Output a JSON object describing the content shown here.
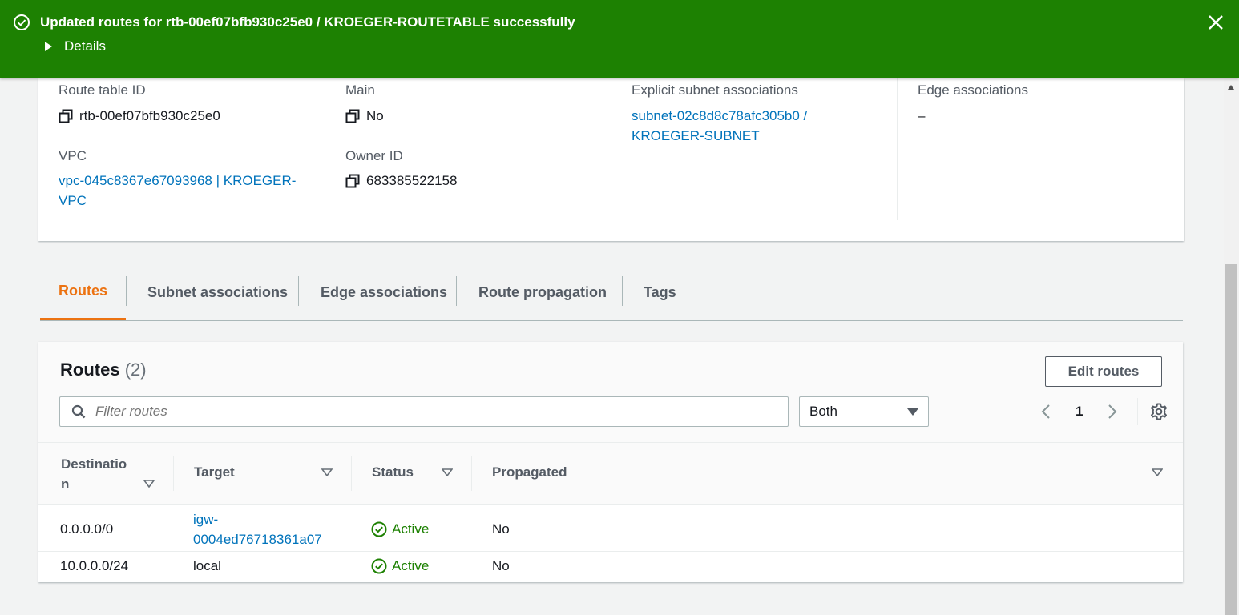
{
  "flash": {
    "message": "Updated routes for rtb-00ef07bfb930c25e0 / KROEGER-ROUTETABLE successfully",
    "details_label": "Details",
    "color": "#1d8102"
  },
  "details": {
    "route_table_id_label": "Route table ID",
    "route_table_id": "rtb-00ef07bfb930c25e0",
    "vpc_label": "VPC",
    "vpc_line1": "vpc-045c8367e67093968 | KROEGER-",
    "vpc_line2": "VPC",
    "main_label": "Main",
    "main_value": "No",
    "owner_id_label": "Owner ID",
    "owner_id": "683385522158",
    "explicit_label": "Explicit subnet associations",
    "explicit_line1": "subnet-02c8d8c78afc305b0 /",
    "explicit_line2": "KROEGER-SUBNET",
    "edge_label": "Edge associations",
    "edge_value": "–"
  },
  "tabs": [
    {
      "label": "Routes",
      "active": true
    },
    {
      "label": "Subnet associations"
    },
    {
      "label": "Edge associations"
    },
    {
      "label": "Route propagation"
    },
    {
      "label": "Tags"
    }
  ],
  "routes_panel": {
    "title": "Routes",
    "count": "(2)",
    "edit_button": "Edit routes",
    "filter_placeholder": "Filter routes",
    "select_value": "Both",
    "page": "1"
  },
  "table": {
    "headers": {
      "destination_line1": "Destinatio",
      "destination_line2": "n",
      "target": "Target",
      "status": "Status",
      "propagated": "Propagated"
    },
    "rows": [
      {
        "destination": "0.0.0.0/0",
        "target_line1": "igw-",
        "target_line2": "0004ed76718361a07",
        "status": "Active",
        "propagated": "No"
      },
      {
        "destination": "10.0.0.0/24",
        "target": "local",
        "status": "Active",
        "propagated": "No"
      }
    ]
  },
  "colors": {
    "accent_tab": "#ec7211",
    "link": "#0073bb",
    "success": "#1d8102"
  },
  "icons": [
    "success-check-icon",
    "close-icon",
    "caret-right-icon",
    "copy-icon",
    "search-icon",
    "caret-down-icon",
    "chevron-left-icon",
    "chevron-right-icon",
    "gear-icon",
    "sort-icon",
    "status-ok-icon"
  ]
}
